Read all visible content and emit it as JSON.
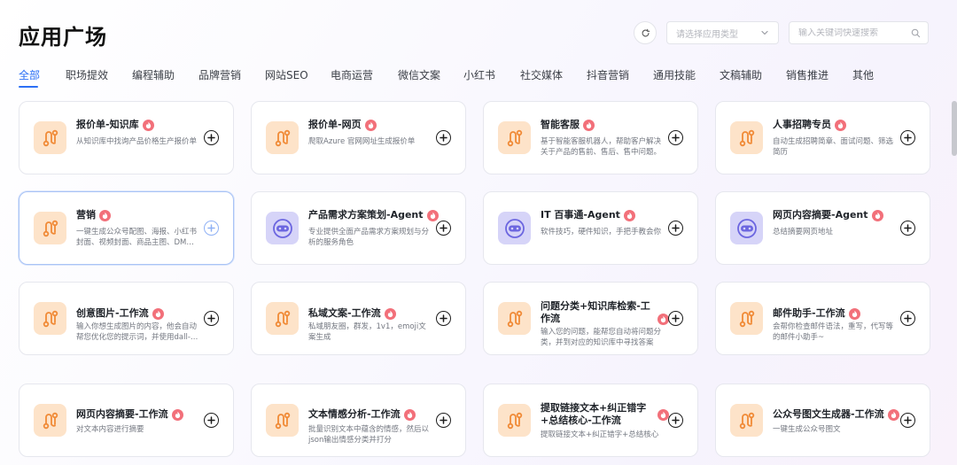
{
  "header": {
    "title": "应用广场",
    "type_select_placeholder": "请选择应用类型",
    "search_placeholder": "输入关键词快速搜索"
  },
  "tabs": [
    {
      "label": "全部",
      "active": true
    },
    {
      "label": "职场提效"
    },
    {
      "label": "编程辅助"
    },
    {
      "label": "品牌营销"
    },
    {
      "label": "网站SEO"
    },
    {
      "label": "电商运营"
    },
    {
      "label": "微信文案"
    },
    {
      "label": "小红书"
    },
    {
      "label": "社交媒体"
    },
    {
      "label": "抖音营销"
    },
    {
      "label": "通用技能"
    },
    {
      "label": "文稿辅助"
    },
    {
      "label": "销售推进"
    },
    {
      "label": "其他"
    }
  ],
  "cards": [
    {
      "name": "报价单-知识库",
      "desc": "从知识库中找询产品价格生产报价单",
      "icon": "workflow-icon"
    },
    {
      "name": "报价单-网页",
      "desc": "爬取Azure 官网网址生成报价单",
      "icon": "workflow-icon"
    },
    {
      "name": "智能客服",
      "desc": "基于智能客服机器人，帮助客户解决关于产品的售前、售后、售中问题。",
      "icon": "workflow-icon"
    },
    {
      "name": "人事招聘专员",
      "desc": "自动生成招聘简章、面试问题、筛选简历",
      "icon": "workflow-icon"
    },
    {
      "name": "营销",
      "desc": "一键生成公众号配图、海报、小红书封面、视频封面、商品主图、DM宣…",
      "icon": "workflow-icon"
    },
    {
      "name": "产品需求方案策划-Agent",
      "desc": "专业提供全面产品需求方案规划与分析的服务角色",
      "icon": "bot-icon"
    },
    {
      "name": "IT 百事通-Agent",
      "desc": "软件技巧，硬件知识，手把手教会你",
      "icon": "bot-icon"
    },
    {
      "name": "网页内容摘要-Agent",
      "desc": "总结摘要网页地址",
      "icon": "bot-icon"
    },
    {
      "name": "创意图片-工作流",
      "desc": "输入你想生成图片的内容，他会自动帮您优化您的提示词，并使用dall-e…",
      "icon": "workflow-icon"
    },
    {
      "name": "私域文案-工作流",
      "desc": "私域朋友圈，群发，1v1，emoji文案生成",
      "icon": "workflow-icon"
    },
    {
      "name": "问题分类+知识库检索-工作流",
      "desc": "输入您的问题，能帮您自动将问题分类，并到对应的知识库中寻找答案",
      "icon": "workflow-icon"
    },
    {
      "name": "邮件助手-工作流",
      "desc": "会帮你检查邮件语法，重写，代写等的邮件小助手~",
      "icon": "workflow-icon"
    },
    {
      "name": "网页内容摘要-工作流",
      "desc": "对文本内容进行摘要",
      "icon": "workflow-icon"
    },
    {
      "name": "文本情感分析-工作流",
      "desc": "批量识别文本中蕴含的情感，然后以json输出情感分类并打分",
      "icon": "workflow-icon"
    },
    {
      "name": "提取链接文本+纠正错字+总结核心-工作流",
      "desc": "提取链接文本+纠正错字+总结核心",
      "icon": "workflow-icon"
    },
    {
      "name": "公众号图文生成器-工作流",
      "desc": "一键生成公众号图文",
      "icon": "workflow-icon"
    }
  ],
  "colors": {
    "accent": "#2b6ff5",
    "tag": "#f2707a",
    "workflow_icon_bg": "#fde3c9",
    "workflow_icon_fg": "#f08a36",
    "bot_icon_bg": "#d6d4f8",
    "bot_icon_fg": "#6c66e0"
  }
}
